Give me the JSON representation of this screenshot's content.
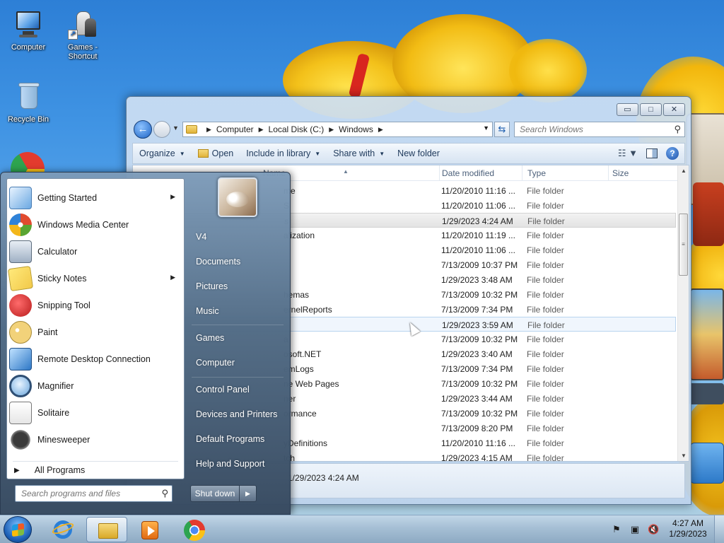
{
  "desktop": {
    "icons": [
      {
        "label": "Computer"
      },
      {
        "label": "Games -",
        "label2": "Shortcut"
      },
      {
        "label": "Recycle Bin"
      }
    ]
  },
  "explorer": {
    "breadcrumbs": [
      "Computer",
      "Local Disk (C:)",
      "Windows"
    ],
    "search_placeholder": "Search Windows",
    "commands": {
      "organize": "Organize",
      "open": "Open",
      "include": "Include in library",
      "share": "Share with",
      "new_folder": "New folder"
    },
    "columns": {
      "name": "Name",
      "date": "Date modified",
      "type": "Type",
      "size": "Size"
    },
    "rows": [
      {
        "name": "me",
        "date": "11/20/2010 11:16 ...",
        "type": "File folder"
      },
      {
        "name": "S",
        "date": "11/20/2010 11:06 ...",
        "type": "File folder"
      },
      {
        "name": "s",
        "date": "1/29/2023 4:24 AM",
        "type": "File folder"
      },
      {
        "name": "alization",
        "date": "11/20/2010 11:19 ...",
        "type": "File folder"
      },
      {
        "name": "",
        "date": "11/20/2010 11:06 ...",
        "type": "File folder"
      },
      {
        "name": "",
        "date": "7/13/2009 10:37 PM",
        "type": "File folder"
      },
      {
        "name": "",
        "date": "1/29/2023 3:48 AM",
        "type": "File folder"
      },
      {
        "name": "hemas",
        "date": "7/13/2009 10:32 PM",
        "type": "File folder"
      },
      {
        "name": "ernelReports",
        "date": "7/13/2009 7:34 PM",
        "type": "File folder"
      },
      {
        "name": "",
        "date": "1/29/2023 3:59 AM",
        "type": "File folder"
      },
      {
        "name": "a",
        "date": "7/13/2009 10:32 PM",
        "type": "File folder"
      },
      {
        "name": "osoft.NET",
        "date": "1/29/2023 3:40 AM",
        "type": "File folder"
      },
      {
        "name": "emLogs",
        "date": "7/13/2009 7:34 PM",
        "type": "File folder"
      },
      {
        "name": "ne Web Pages",
        "date": "7/13/2009 10:32 PM",
        "type": "File folder"
      },
      {
        "name": "ner",
        "date": "1/29/2023 3:44 AM",
        "type": "File folder"
      },
      {
        "name": "ormance",
        "date": "7/13/2009 10:32 PM",
        "type": "File folder"
      },
      {
        "name": "",
        "date": "7/13/2009 8:20 PM",
        "type": "File folder"
      },
      {
        "name": "yDefinitions",
        "date": "11/20/2010 11:16 ...",
        "type": "File folder"
      },
      {
        "name": "tch",
        "date": "1/29/2023 4:15 AM",
        "type": "File folder"
      }
    ],
    "details_text": "1/29/2023 4:24 AM"
  },
  "start_menu": {
    "programs": [
      {
        "label": "Getting Started",
        "icon": "getting-started-icon",
        "has_submenu": true
      },
      {
        "label": "Windows Media Center",
        "icon": "media-center-icon",
        "has_submenu": false
      },
      {
        "label": "Calculator",
        "icon": "calculator-icon",
        "has_submenu": false
      },
      {
        "label": "Sticky Notes",
        "icon": "sticky-notes-icon",
        "has_submenu": true
      },
      {
        "label": "Snipping Tool",
        "icon": "snipping-tool-icon",
        "has_submenu": false
      },
      {
        "label": "Paint",
        "icon": "paint-icon",
        "has_submenu": false
      },
      {
        "label": "Remote Desktop Connection",
        "icon": "remote-desktop-icon",
        "has_submenu": false
      },
      {
        "label": "Magnifier",
        "icon": "magnifier-icon",
        "has_submenu": false
      },
      {
        "label": "Solitaire",
        "icon": "solitaire-icon",
        "has_submenu": false
      },
      {
        "label": "Minesweeper",
        "icon": "minesweeper-icon",
        "has_submenu": false
      }
    ],
    "all_programs": "All Programs",
    "search_placeholder": "Search programs and files",
    "right_items": {
      "user": "V4",
      "documents": "Documents",
      "pictures": "Pictures",
      "music": "Music",
      "games": "Games",
      "computer": "Computer",
      "control_panel": "Control Panel",
      "devices": "Devices and Printers",
      "default_programs": "Default Programs",
      "help": "Help and Support"
    },
    "shutdown": "Shut down"
  },
  "taskbar": {
    "time": "4:27 AM",
    "date": "1/29/2023",
    "pinned": [
      "internet-explorer-icon",
      "windows-explorer-icon",
      "media-player-icon",
      "chrome-icon"
    ]
  },
  "colors": {
    "taskbar": "#a5bed4",
    "start_menu_dark": "#374a60",
    "selection": "#e3e3e3",
    "hover": "#f0f6fd"
  }
}
